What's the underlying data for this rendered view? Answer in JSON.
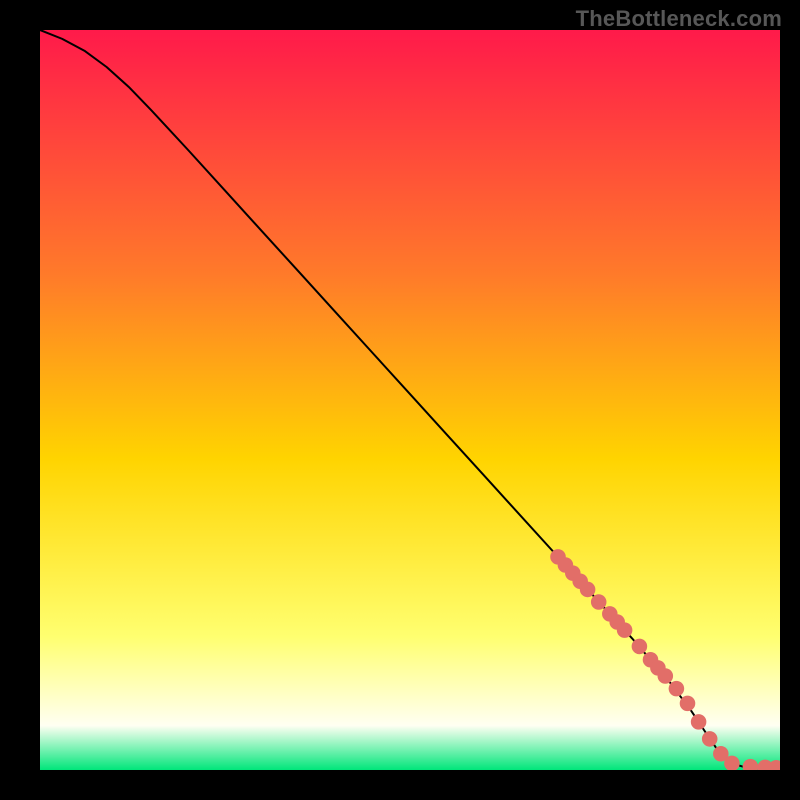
{
  "watermark": "TheBottleneck.com",
  "colors": {
    "gradient_top": "#ff1a4a",
    "gradient_mid1": "#ff7a2a",
    "gradient_mid2": "#ffd400",
    "gradient_mid3": "#ffff70",
    "gradient_mid4": "#fffff2",
    "gradient_bottom": "#00e67a",
    "curve": "#000000",
    "marker": "#e26e68"
  },
  "chart_data": {
    "type": "line",
    "title": "",
    "xlabel": "",
    "ylabel": "",
    "xlim": [
      0,
      100
    ],
    "ylim": [
      0,
      100
    ],
    "series": [
      {
        "name": "curve",
        "x": [
          0,
          3,
          6,
          9,
          12,
          15,
          20,
          25,
          30,
          35,
          40,
          45,
          50,
          55,
          60,
          65,
          70,
          75,
          80,
          85,
          88,
          90,
          91.5,
          92.5,
          93.5,
          95,
          97,
          98.5,
          100
        ],
        "y": [
          100,
          98.8,
          97.2,
          95.0,
          92.3,
          89.2,
          83.8,
          78.3,
          72.8,
          67.3,
          61.8,
          56.3,
          50.8,
          45.3,
          39.8,
          34.3,
          28.8,
          23.3,
          17.8,
          12.0,
          8.0,
          5.0,
          2.8,
          1.6,
          0.9,
          0.45,
          0.35,
          0.3,
          0.3
        ]
      },
      {
        "name": "markers",
        "mode": "scatter",
        "x": [
          70,
          71,
          72,
          73,
          74,
          75.5,
          77,
          78,
          79,
          81,
          82.5,
          83.5,
          84.5,
          86,
          87.5,
          89,
          90.5,
          92,
          93.5,
          96,
          98,
          99.5
        ],
        "y": [
          28.8,
          27.7,
          26.6,
          25.5,
          24.4,
          22.7,
          21.1,
          20.0,
          18.9,
          16.7,
          14.9,
          13.8,
          12.7,
          11.0,
          9.0,
          6.5,
          4.2,
          2.2,
          0.9,
          0.45,
          0.35,
          0.3
        ]
      }
    ]
  }
}
